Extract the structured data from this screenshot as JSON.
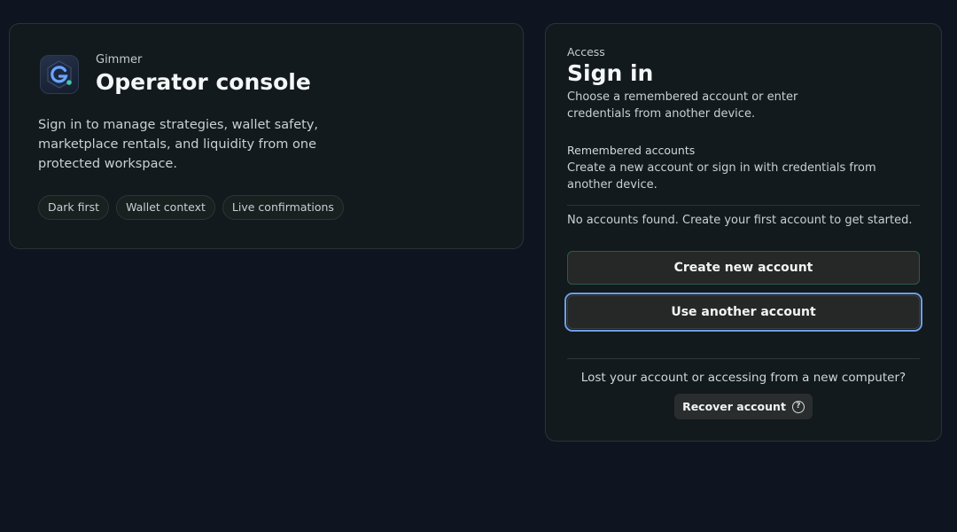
{
  "brand": {
    "name": "Gimmer",
    "title": "Operator console",
    "logo_icon": "gimmer-logo-icon",
    "description": "Sign in to manage strategies, wallet safety, marketplace rentals, and liquidity from one protected workspace.",
    "chips": [
      "Dark first",
      "Wallet context",
      "Live confirmations"
    ]
  },
  "signin": {
    "eyebrow": "Access",
    "title": "Sign in",
    "description": "Choose a remembered account or enter credentials from another device.",
    "remembered_label": "Remembered accounts",
    "remembered_description": "Create a new account or sign in with credentials from another device.",
    "empty_message": "No accounts found. Create your first account to get started.",
    "create_button": "Create new account",
    "other_button": "Use another account",
    "lost_message": "Lost your account or accessing from a new computer?",
    "recover_button": "Recover account",
    "recover_icon": "question-circle-icon"
  },
  "colors": {
    "background": "#0f1520",
    "card": "#121a1d",
    "focus_ring": "#6f9ee8",
    "create_border": "#2e5a47",
    "logo_accent": "#5aa0ff"
  }
}
